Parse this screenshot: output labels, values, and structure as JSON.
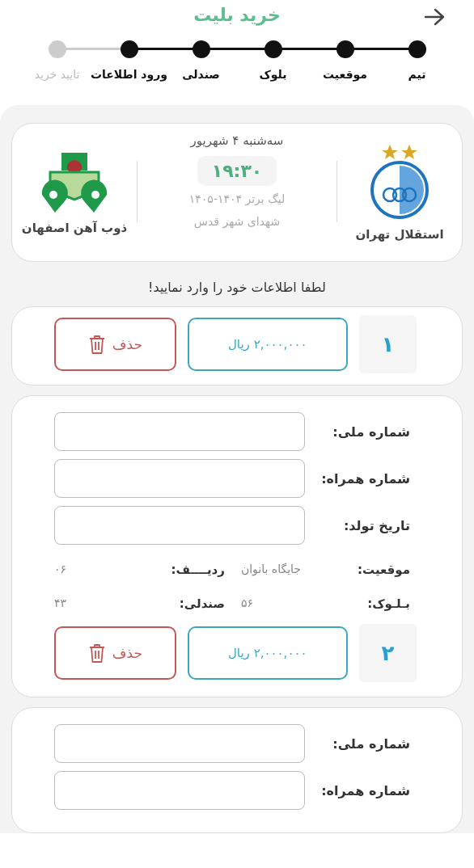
{
  "header": {
    "title": "خرید بلیت"
  },
  "steps": [
    {
      "label": "تیم",
      "done": true
    },
    {
      "label": "موقعیت",
      "done": true
    },
    {
      "label": "بلوک",
      "done": true
    },
    {
      "label": "صندلی",
      "done": true
    },
    {
      "label": "ورود اطلاعات",
      "done": true
    },
    {
      "label": "تایید خرید",
      "done": false
    }
  ],
  "match": {
    "home_team": "استقلال تهران",
    "away_team": "ذوب آهن اصفهان",
    "date": "سه‌شنبه ۴ شهریور",
    "time": "۱۹:۳۰",
    "league": "لیگ برتر ۱۴۰۴-۱۴۰۵",
    "stadium": "شهدای شهر قدس"
  },
  "prompt": "لطفا اطلاعات خود را وارد نمایید!",
  "tickets": [
    {
      "number": "۱",
      "price": "۲,۰۰۰,۰۰۰ ریال",
      "delete": "حذف"
    },
    {
      "fields": [
        {
          "label": "شماره ملی:"
        },
        {
          "label": "شماره همراه:"
        },
        {
          "label": "تاریخ تولد:"
        }
      ],
      "info": [
        {
          "label": "موقعیت:",
          "value": "جایگاه بانوان"
        },
        {
          "label": "ردیــــف:",
          "value": "۰۶"
        },
        {
          "label": "بـلـوک:",
          "value": "۵۶"
        },
        {
          "label": "صندلی:",
          "value": "۴۳"
        }
      ],
      "number": "۲",
      "price": "۲,۰۰۰,۰۰۰ ریال",
      "delete": "حذف"
    },
    {
      "fields": [
        {
          "label": "شماره ملی:"
        },
        {
          "label": "شماره همراه:"
        }
      ]
    }
  ]
}
